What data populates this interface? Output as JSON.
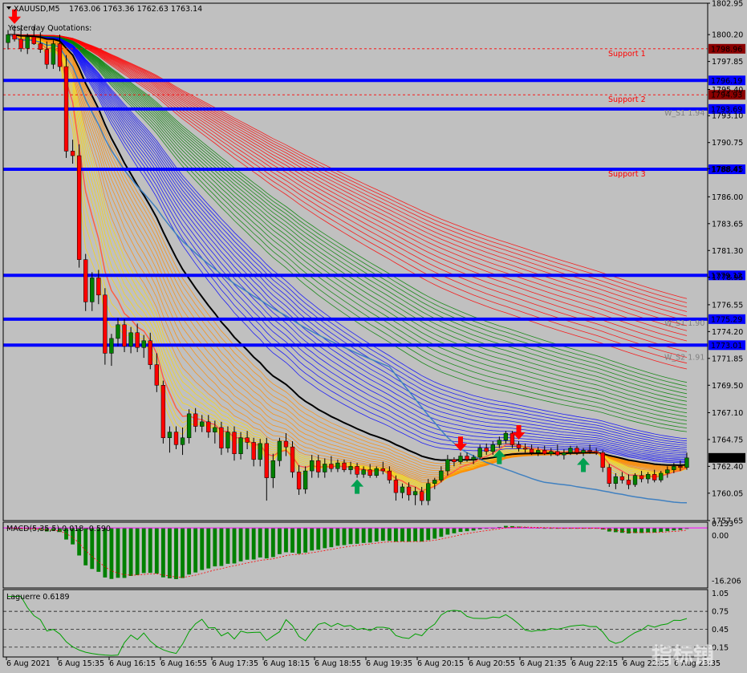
{
  "header": {
    "symbol": "XAUUSD,M5",
    "ohlc": "1763.06 1763.36 1762.63 1763.14",
    "yesterday_label": "Yesterday Quotations:"
  },
  "colors": {
    "background": "#c0c0c0",
    "level_line": "#0000ff",
    "support_text": "#ff0000",
    "bull_candle": "#008000",
    "bear_candle": "#ff0000",
    "ribbon_red": "#ff0000",
    "ribbon_green": "#008000",
    "ribbon_blue": "#0000ff",
    "ribbon_orange": "#ff8c00",
    "ribbon_yellow": "#ffd700",
    "ema_black": "#000000",
    "slow_ma": "#4080c0",
    "fast_ma": "#ff6040",
    "macd_line": "#ff00ff",
    "laguerre_line": "#00a000"
  },
  "chart_data": [
    {
      "type": "candlestick",
      "title": "XAUUSD,M5",
      "ylim": [
        1757.65,
        1802.95
      ],
      "y_ticks": [
        1802.95,
        1800.2,
        1797.85,
        1795.4,
        1793.1,
        1790.75,
        1788.45,
        1786.0,
        1783.65,
        1781.3,
        1778.95,
        1776.55,
        1774.2,
        1771.85,
        1769.5,
        1767.1,
        1764.75,
        1762.4,
        1760.05,
        1757.65
      ],
      "x_ticks": [
        "6 Aug 2021",
        "6 Aug 15:35",
        "6 Aug 16:15",
        "6 Aug 16:55",
        "6 Aug 17:35",
        "6 Aug 18:15",
        "6 Aug 18:55",
        "6 Aug 19:35",
        "6 Aug 20:15",
        "6 Aug 20:55",
        "6 Aug 21:35",
        "6 Aug 22:15",
        "6 Aug 22:55",
        "6 Aug 23:35"
      ],
      "last_price": "1763.14",
      "levels": [
        {
          "price": 1798.96,
          "label": "1798.96",
          "style": "dashed",
          "text": "Support 1"
        },
        {
          "price": 1796.19,
          "label": "1796.19",
          "style": "solid",
          "text": ""
        },
        {
          "price": 1794.93,
          "label": "1794.93",
          "style": "dashed",
          "text": "Support 2"
        },
        {
          "price": 1793.69,
          "label": "1793.69",
          "style": "solid",
          "text": ""
        },
        {
          "price": 1788.41,
          "label": "1788.41",
          "style": "solid",
          "text": "Support 3"
        },
        {
          "price": 1779.12,
          "label": "1779.12",
          "style": "solid",
          "text": ""
        },
        {
          "price": 1775.29,
          "label": "1775.29",
          "style": "solid",
          "text": ""
        },
        {
          "price": 1773.01,
          "label": "1773.01",
          "style": "solid",
          "text": ""
        }
      ],
      "side_notes": [
        {
          "text": "W_S1 1.94",
          "price": 1793.4
        },
        {
          "text": "W_S1 1.90",
          "price": 1775.0
        },
        {
          "text": "W_S2 1.91",
          "price": 1772.0
        }
      ],
      "candles": [
        [
          1799.5,
          1800.6,
          1798.9,
          1800.2
        ],
        [
          1800.2,
          1801.0,
          1799.6,
          1799.8
        ],
        [
          1799.8,
          1800.8,
          1798.7,
          1799.0
        ],
        [
          1799.0,
          1800.3,
          1798.5,
          1800.0
        ],
        [
          1800.0,
          1800.9,
          1799.3,
          1799.4
        ],
        [
          1799.4,
          1800.4,
          1798.6,
          1798.9
        ],
        [
          1798.9,
          1799.6,
          1797.2,
          1797.6
        ],
        [
          1797.6,
          1799.7,
          1797.2,
          1799.4
        ],
        [
          1799.4,
          1800.2,
          1797.0,
          1797.4
        ],
        [
          1797.4,
          1798.4,
          1789.4,
          1790.0
        ],
        [
          1790.0,
          1791.0,
          1788.9,
          1789.6
        ],
        [
          1789.6,
          1790.6,
          1779.8,
          1780.5
        ],
        [
          1780.5,
          1781.0,
          1776.0,
          1776.8
        ],
        [
          1776.8,
          1779.4,
          1776.0,
          1778.9
        ],
        [
          1778.9,
          1779.6,
          1776.6,
          1777.4
        ],
        [
          1777.4,
          1778.0,
          1771.3,
          1772.3
        ],
        [
          1772.3,
          1774.0,
          1771.2,
          1773.6
        ],
        [
          1773.6,
          1775.4,
          1772.9,
          1774.8
        ],
        [
          1774.8,
          1775.3,
          1772.4,
          1772.9
        ],
        [
          1772.9,
          1774.6,
          1772.3,
          1774.1
        ],
        [
          1774.1,
          1774.9,
          1772.4,
          1772.8
        ],
        [
          1772.8,
          1773.9,
          1771.9,
          1773.4
        ],
        [
          1773.4,
          1774.1,
          1770.9,
          1771.3
        ],
        [
          1771.3,
          1772.3,
          1768.9,
          1769.5
        ],
        [
          1769.5,
          1769.9,
          1764.4,
          1764.9
        ],
        [
          1764.9,
          1765.9,
          1763.6,
          1765.4
        ],
        [
          1765.4,
          1765.9,
          1763.9,
          1764.3
        ],
        [
          1764.3,
          1765.8,
          1763.4,
          1764.9
        ],
        [
          1764.9,
          1767.4,
          1764.4,
          1767.0
        ],
        [
          1767.0,
          1767.5,
          1765.4,
          1765.9
        ],
        [
          1765.9,
          1766.9,
          1765.4,
          1766.3
        ],
        [
          1766.3,
          1766.9,
          1764.9,
          1765.4
        ],
        [
          1765.4,
          1766.4,
          1764.4,
          1765.8
        ],
        [
          1765.8,
          1766.3,
          1763.4,
          1764.0
        ],
        [
          1764.0,
          1765.9,
          1763.6,
          1765.4
        ],
        [
          1765.4,
          1765.9,
          1762.9,
          1763.5
        ],
        [
          1763.5,
          1765.4,
          1763.0,
          1764.9
        ],
        [
          1764.9,
          1765.5,
          1763.9,
          1764.5
        ],
        [
          1764.5,
          1764.9,
          1762.4,
          1763.0
        ],
        [
          1763.0,
          1764.8,
          1762.4,
          1764.4
        ],
        [
          1764.4,
          1764.9,
          1759.4,
          1761.4
        ],
        [
          1761.4,
          1763.5,
          1760.5,
          1762.9
        ],
        [
          1762.9,
          1764.9,
          1762.4,
          1764.6
        ],
        [
          1764.6,
          1765.3,
          1763.3,
          1764.1
        ],
        [
          1764.1,
          1764.6,
          1761.4,
          1761.9
        ],
        [
          1761.9,
          1762.5,
          1759.9,
          1760.4
        ],
        [
          1760.4,
          1762.4,
          1760.0,
          1762.0
        ],
        [
          1762.0,
          1763.4,
          1761.4,
          1762.9
        ],
        [
          1762.9,
          1763.4,
          1761.4,
          1761.9
        ],
        [
          1761.9,
          1763.1,
          1761.4,
          1762.6
        ],
        [
          1762.6,
          1763.3,
          1761.9,
          1762.2
        ],
        [
          1762.2,
          1763.0,
          1761.9,
          1762.7
        ],
        [
          1762.7,
          1763.0,
          1761.9,
          1762.1
        ],
        [
          1762.1,
          1762.8,
          1761.7,
          1762.4
        ],
        [
          1762.4,
          1762.7,
          1761.4,
          1761.7
        ],
        [
          1761.7,
          1762.4,
          1761.4,
          1762.1
        ],
        [
          1762.1,
          1762.6,
          1761.4,
          1761.6
        ],
        [
          1761.6,
          1762.4,
          1761.4,
          1762.2
        ],
        [
          1762.2,
          1762.8,
          1761.7,
          1762.0
        ],
        [
          1762.0,
          1762.4,
          1760.9,
          1761.2
        ],
        [
          1761.2,
          1761.6,
          1759.4,
          1760.1
        ],
        [
          1760.1,
          1760.9,
          1759.6,
          1760.6
        ],
        [
          1760.6,
          1761.0,
          1759.4,
          1759.9
        ],
        [
          1759.9,
          1760.6,
          1759.0,
          1760.2
        ],
        [
          1760.2,
          1760.6,
          1759.0,
          1759.4
        ],
        [
          1759.4,
          1761.3,
          1759.0,
          1760.9
        ],
        [
          1760.9,
          1761.4,
          1760.4,
          1761.2
        ],
        [
          1761.2,
          1762.4,
          1761.0,
          1762.0
        ],
        [
          1762.0,
          1763.4,
          1761.6,
          1763.0
        ],
        [
          1763.0,
          1763.2,
          1762.4,
          1762.8
        ],
        [
          1762.8,
          1763.6,
          1762.6,
          1763.3
        ],
        [
          1763.3,
          1763.6,
          1762.8,
          1763.0
        ],
        [
          1763.0,
          1763.4,
          1762.6,
          1763.2
        ],
        [
          1763.2,
          1764.3,
          1763.0,
          1764.0
        ],
        [
          1764.0,
          1764.4,
          1763.4,
          1763.7
        ],
        [
          1763.7,
          1764.6,
          1763.4,
          1764.3
        ],
        [
          1764.3,
          1765.0,
          1764.0,
          1764.7
        ],
        [
          1764.7,
          1765.5,
          1764.4,
          1765.3
        ],
        [
          1765.3,
          1765.5,
          1764.0,
          1764.3
        ],
        [
          1764.3,
          1764.6,
          1763.7,
          1764.0
        ],
        [
          1764.0,
          1764.4,
          1763.6,
          1763.9
        ],
        [
          1763.9,
          1764.3,
          1763.4,
          1763.6
        ],
        [
          1763.6,
          1764.1,
          1763.3,
          1763.8
        ],
        [
          1763.8,
          1764.2,
          1763.4,
          1763.5
        ],
        [
          1763.5,
          1764.0,
          1763.3,
          1763.7
        ],
        [
          1763.7,
          1764.3,
          1763.3,
          1763.4
        ],
        [
          1763.4,
          1763.9,
          1763.0,
          1763.6
        ],
        [
          1763.6,
          1764.2,
          1763.4,
          1764.0
        ],
        [
          1764.0,
          1764.2,
          1763.4,
          1763.6
        ],
        [
          1763.6,
          1764.0,
          1763.3,
          1763.8
        ],
        [
          1763.8,
          1764.3,
          1763.5,
          1763.7
        ],
        [
          1763.7,
          1764.0,
          1763.4,
          1763.6
        ],
        [
          1763.6,
          1763.8,
          1761.9,
          1762.3
        ],
        [
          1762.3,
          1762.6,
          1760.6,
          1760.9
        ],
        [
          1760.9,
          1761.8,
          1760.4,
          1761.5
        ],
        [
          1761.5,
          1761.9,
          1760.9,
          1761.2
        ],
        [
          1761.2,
          1761.7,
          1760.4,
          1760.8
        ],
        [
          1760.8,
          1761.8,
          1760.6,
          1761.6
        ],
        [
          1761.6,
          1762.0,
          1761.0,
          1761.3
        ],
        [
          1761.3,
          1761.9,
          1760.9,
          1761.7
        ],
        [
          1761.7,
          1762.1,
          1761.0,
          1761.2
        ],
        [
          1761.2,
          1762.0,
          1761.0,
          1761.8
        ],
        [
          1761.8,
          1762.4,
          1761.4,
          1762.1
        ],
        [
          1762.1,
          1762.7,
          1761.8,
          1762.4
        ],
        [
          1762.4,
          1762.9,
          1762.0,
          1762.3
        ],
        [
          1762.3,
          1763.6,
          1762.1,
          1763.14
        ]
      ]
    },
    {
      "type": "bar",
      "title": "MACD(5,35,5) 0.018 -0.590",
      "y_ticks": [
        "0.133",
        "0.00",
        "-16.206"
      ],
      "ylim": [
        -18.0,
        1.5
      ]
    },
    {
      "type": "line",
      "title": "Laguerre 0.6189",
      "ylim": [
        0,
        1.1
      ],
      "y_ticks": [
        "1.05",
        "0.75",
        "0.45",
        "0.15"
      ]
    }
  ],
  "arrows_down": [
    1,
    70,
    79
  ],
  "arrows_up": [
    54,
    76,
    89
  ],
  "watermark": "指标铺"
}
